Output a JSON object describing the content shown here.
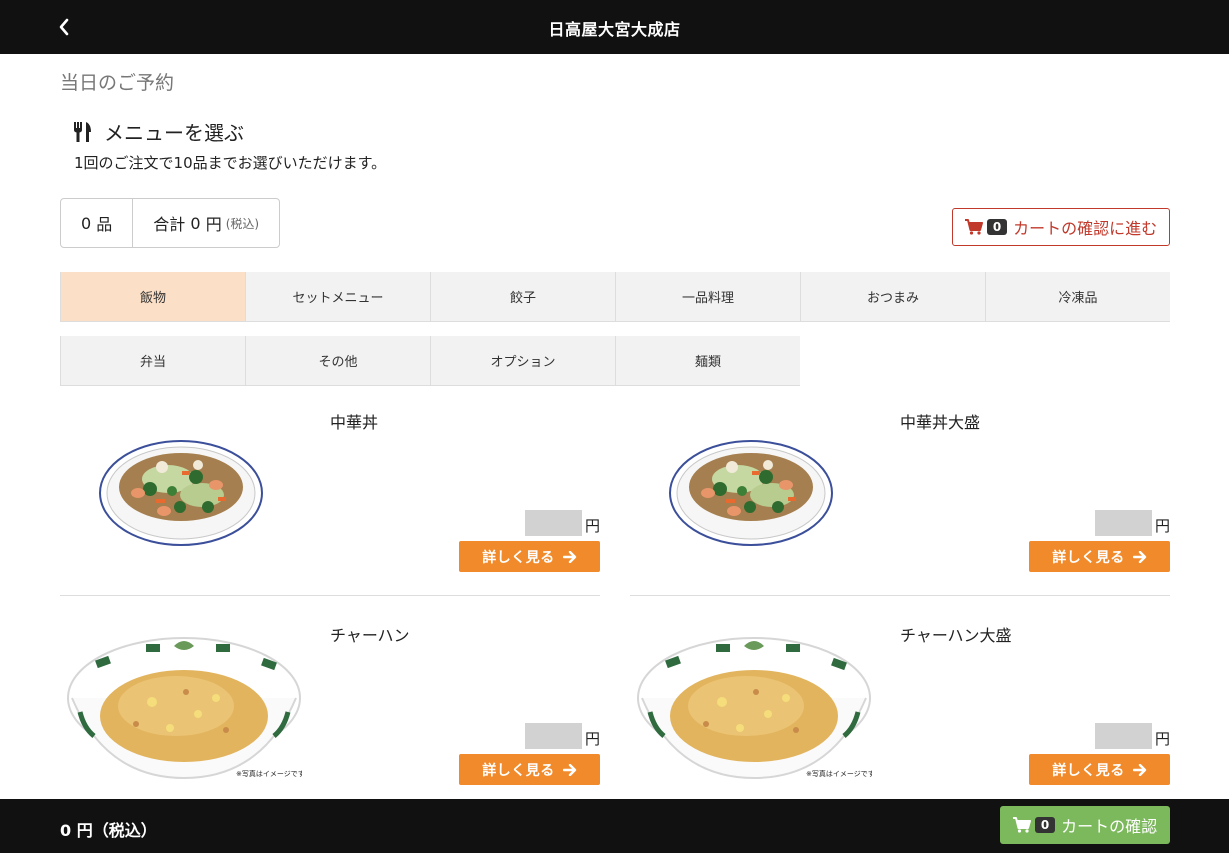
{
  "header": {
    "title": "日高屋大宮大成店",
    "back_icon": "chevron-left-icon"
  },
  "page": {
    "title": "当日のご予約"
  },
  "menu_section": {
    "icon": "utensils-icon",
    "heading": "メニューを選ぶ",
    "note": "1回のご注文で10品までお選びいただけます。"
  },
  "summary": {
    "count": "0",
    "count_unit": "品",
    "total_label": "合計",
    "total_value": "0",
    "currency": "円",
    "tax_note": "(税込)"
  },
  "cart_button": {
    "icon": "cart-icon",
    "count": "0",
    "label": "カートの確認に進む",
    "color": "#c0392b"
  },
  "tabs": [
    {
      "label": "飯物",
      "active": true
    },
    {
      "label": "セットメニュー"
    },
    {
      "label": "餃子"
    },
    {
      "label": "一品料理"
    },
    {
      "label": "おつまみ"
    },
    {
      "label": "冷凍品"
    },
    {
      "label": "弁当"
    },
    {
      "label": "その他"
    },
    {
      "label": "オプション"
    },
    {
      "label": "麺類"
    }
  ],
  "items": [
    {
      "name": "中華丼",
      "price_unit": "円",
      "button": "詳しく見る"
    },
    {
      "name": "中華丼大盛",
      "price_unit": "円",
      "button": "詳しく見る"
    },
    {
      "name": "チャーハン",
      "price_unit": "円",
      "button": "詳しく見る",
      "image_note": "※写真はイメージです。"
    },
    {
      "name": "チャーハン大盛",
      "price_unit": "円",
      "button": "詳しく見る",
      "image_note": "※写真はイメージです。"
    }
  ],
  "footer": {
    "total": "0 円（税込）",
    "cart_icon": "cart-icon",
    "cart_count": "0",
    "cart_label": "カートの確認"
  },
  "colors": {
    "accent": "#f08a2a",
    "active_tab": "#fbdfc6",
    "confirm": "#7cb85c",
    "header": "#111111"
  }
}
